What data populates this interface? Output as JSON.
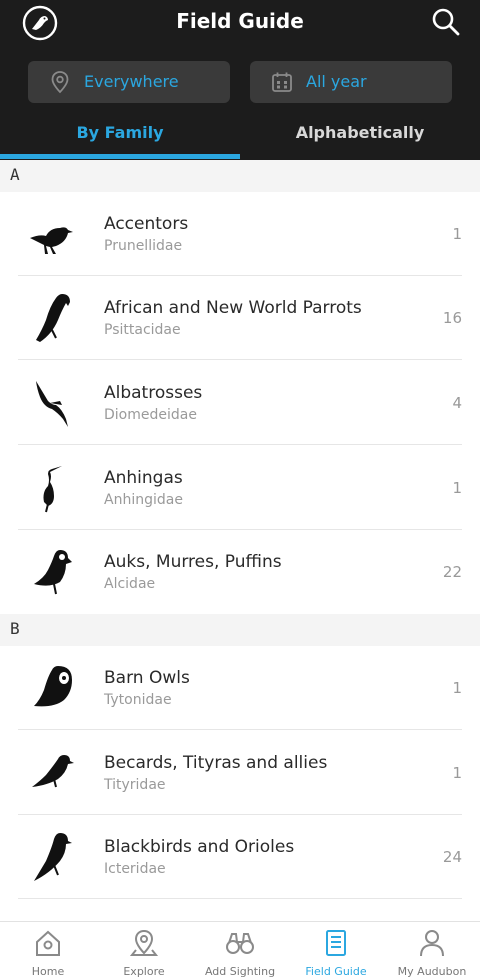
{
  "header": {
    "title": "Field Guide",
    "logo_icon": "audubon-bird-logo-icon",
    "search_icon": "search-icon"
  },
  "filters": {
    "location": {
      "label": "Everywhere",
      "icon": "location-pin-icon"
    },
    "season": {
      "label": "All year",
      "icon": "calendar-icon"
    }
  },
  "tabs": [
    {
      "label": "By Family",
      "active": true
    },
    {
      "label": "Alphabetically",
      "active": false
    }
  ],
  "sections": [
    {
      "letter": "A",
      "items": [
        {
          "name": "Accentors",
          "family": "Prunellidae",
          "count": "1",
          "icon": "accentor-silhouette-icon"
        },
        {
          "name": "African and New World Parrots",
          "family": "Psittacidae",
          "count": "16",
          "icon": "parrot-silhouette-icon"
        },
        {
          "name": "Albatrosses",
          "family": "Diomedeidae",
          "count": "4",
          "icon": "albatross-silhouette-icon"
        },
        {
          "name": "Anhingas",
          "family": "Anhingidae",
          "count": "1",
          "icon": "anhinga-silhouette-icon"
        },
        {
          "name": "Auks, Murres, Puffins",
          "family": "Alcidae",
          "count": "22",
          "icon": "puffin-silhouette-icon"
        }
      ]
    },
    {
      "letter": "B",
      "items": [
        {
          "name": "Barn Owls",
          "family": "Tytonidae",
          "count": "1",
          "icon": "owl-silhouette-icon"
        },
        {
          "name": "Becards, Tityras and allies",
          "family": "Tityridae",
          "count": "1",
          "icon": "becard-silhouette-icon"
        },
        {
          "name": "Blackbirds and Orioles",
          "family": "Icteridae",
          "count": "24",
          "icon": "blackbird-silhouette-icon"
        }
      ]
    }
  ],
  "bottom_nav": [
    {
      "label": "Home",
      "icon": "home-icon",
      "active": false
    },
    {
      "label": "Explore",
      "icon": "map-pin-icon",
      "active": false
    },
    {
      "label": "Add Sighting",
      "icon": "binoculars-icon",
      "active": false
    },
    {
      "label": "Field Guide",
      "icon": "book-icon",
      "active": true
    },
    {
      "label": "My Audubon",
      "icon": "person-icon",
      "active": false
    }
  ],
  "colors": {
    "accent": "#2ba7e0",
    "header_bg": "#1c1c1c",
    "filter_bg": "#3a3a3a"
  }
}
